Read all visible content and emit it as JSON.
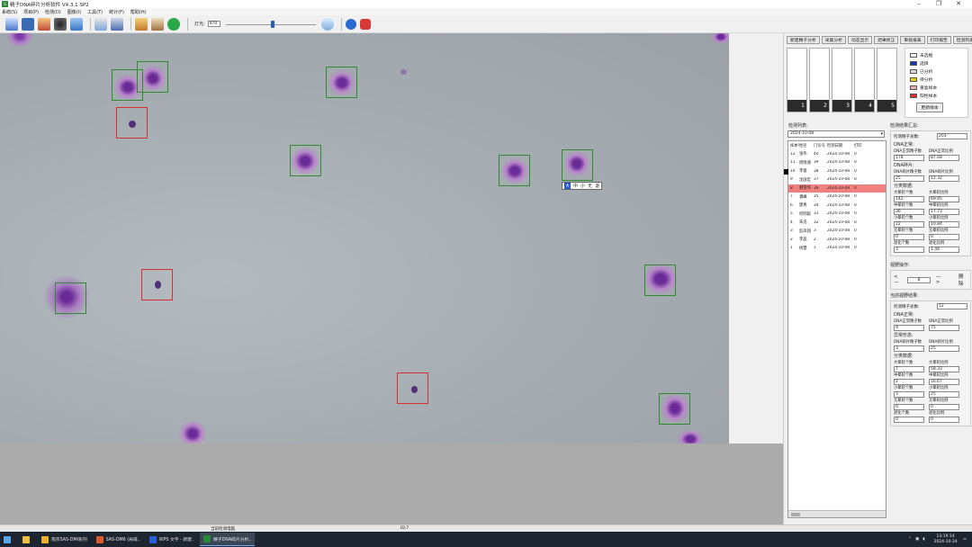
{
  "window": {
    "title": "精子DNA碎片分析软件 V4.3.1 SP2"
  },
  "menu": [
    "系统(S)",
    "项目(P)",
    "检测(D)",
    "图像(I)",
    "工具(T)",
    "统计(F)",
    "帮助(H)"
  ],
  "toolbar": {
    "light_label": "灯光:",
    "light_value": "970",
    "light_level_pct": 50
  },
  "tooltip": {
    "active": "大",
    "options": [
      "中",
      "小",
      "无",
      "退"
    ]
  },
  "tabs": [
    "新建精子分析",
    "采集分析",
    "动态显示",
    "结果修正",
    "审核报表",
    "打印报告",
    "检测列表"
  ],
  "thumbs": [
    "1",
    "2",
    "3",
    "4",
    "5",
    "6"
  ],
  "legend": {
    "items": [
      {
        "label": "未选框",
        "color": "#ffffff"
      },
      {
        "label": "选择",
        "color": "#1838a8"
      },
      {
        "label": "已分析",
        "color": "#d8d8d8"
      },
      {
        "label": "待分析",
        "color": "#e8d020"
      },
      {
        "label": "重复样本",
        "color": "#e8b0b0"
      },
      {
        "label": "阳性样本",
        "color": "#d83030"
      }
    ],
    "button": "更新样本"
  },
  "list": {
    "title": "检测列表:",
    "date": "2024-10-08",
    "headers": [
      "样本号",
      "姓名",
      "门诊号",
      "检测日期",
      "打印"
    ],
    "rows": [
      [
        "12",
        "张伟",
        "40",
        "2024-10-08",
        "0"
      ],
      [
        "11",
        "周晓涵",
        "39",
        "2024-10-08",
        "0"
      ],
      [
        "10",
        "李俊",
        "38",
        "2024-10-08",
        "0"
      ],
      [
        "9",
        "沈国宏",
        "37",
        "2024-10-08",
        "0"
      ],
      [
        "8",
        "顾雪伟",
        "36",
        "2024-10-08",
        "0"
      ],
      [
        "7",
        "潘峰",
        "35",
        "2024-10-08",
        "0"
      ],
      [
        "6",
        "唐青",
        "34",
        "2024-10-08",
        "0"
      ],
      [
        "5",
        "何明毅",
        "33",
        "2024-10-08",
        "0"
      ],
      [
        "4",
        "朱浩",
        "32",
        "2024-10-08",
        "0"
      ],
      [
        "3",
        "彭凤翔",
        "3",
        "2024-10-08",
        "0"
      ],
      [
        "2",
        "李晶",
        "2",
        "2024-10-08",
        "0"
      ],
      [
        "1",
        "杨慧",
        "1",
        "2024-10-08",
        "0"
      ]
    ],
    "selected_index": 4
  },
  "summary": {
    "title": "检测结果汇总:",
    "total_label": "检测精子总数:",
    "total": "203",
    "normal_title": "DNA正常:",
    "normal_count_label": "DNA正常精子数",
    "normal_count": "178",
    "normal_ratio_label": "DNA正常比例",
    "normal_ratio": "87.68",
    "frag_title": "DNA碎片:",
    "frag_count_label": "DNA碎片精子数",
    "frag_count": "25",
    "frag_ratio_label": "DNA碎片比例",
    "frag_ratio": "12.32",
    "class_title": "分类数据:",
    "large_count_label": "大晕轮个数",
    "large_count": "142",
    "large_ratio_label": "大晕轮比例",
    "large_ratio": "69.95",
    "mid_count_label": "中晕轮个数",
    "mid_count": "36",
    "mid_ratio_label": "中晕轮比例",
    "mid_ratio": "17.73",
    "small_count_label": "小晕轮个数",
    "small_count": "22",
    "small_ratio_label": "小晕轮比例",
    "small_ratio": "10.84",
    "none_count_label": "无晕轮个数",
    "none_count": "0",
    "none_ratio_label": "无晕轮比例",
    "none_ratio": "0",
    "deg_count_label": "退化个数",
    "deg_count": "3",
    "deg_ratio_label": "退化比例",
    "deg_ratio": "1.48"
  },
  "field": {
    "ops_title": "视野操作:",
    "prev": "<—",
    "index": "8",
    "next": "—>",
    "delete": "删除",
    "result_title": "当前视野结果:",
    "total_label": "检测精子总数:",
    "total": "12",
    "normal_title": "DNA正常:",
    "normal_count_label": "DNA正常精子数",
    "normal_count": "9",
    "normal_ratio_label": "DNA正常比例",
    "normal_ratio": "75",
    "frag_title": "异常形态:",
    "frag_count_label": "DNA碎片精子数",
    "frag_count": "3",
    "frag_ratio_label": "DNA碎片比例",
    "frag_ratio": "25",
    "class_title": "分类数据:",
    "large_count_label": "大晕轮个数",
    "large_count": "7",
    "large_ratio_label": "大晕轮比例",
    "large_ratio": "58.33",
    "mid_count_label": "中晕轮个数",
    "mid_count": "2",
    "mid_ratio_label": "中晕轮比例",
    "mid_ratio": "16.67",
    "small_count_label": "小晕轮个数",
    "small_count": "3",
    "small_ratio_label": "小晕轮比例",
    "small_ratio": "25",
    "none_count_label": "无晕轮个数",
    "none_count": "0",
    "none_ratio_label": "无晕轮比例",
    "none_ratio": "0",
    "deg_count_label": "退化个数",
    "deg_count": "0",
    "deg_ratio_label": "退化比例",
    "deg_ratio": "0"
  },
  "status": {
    "left": "当前检测电脑",
    "mid": "ID:7"
  },
  "taskbar": {
    "items": [
      "南京SAS-DMI系列",
      "SAS-DM6 (局域..",
      "WPS 文字 - 新建..",
      "精子DNA碎片分析.."
    ],
    "time": "13:19:14",
    "date": "2024-10-24"
  }
}
